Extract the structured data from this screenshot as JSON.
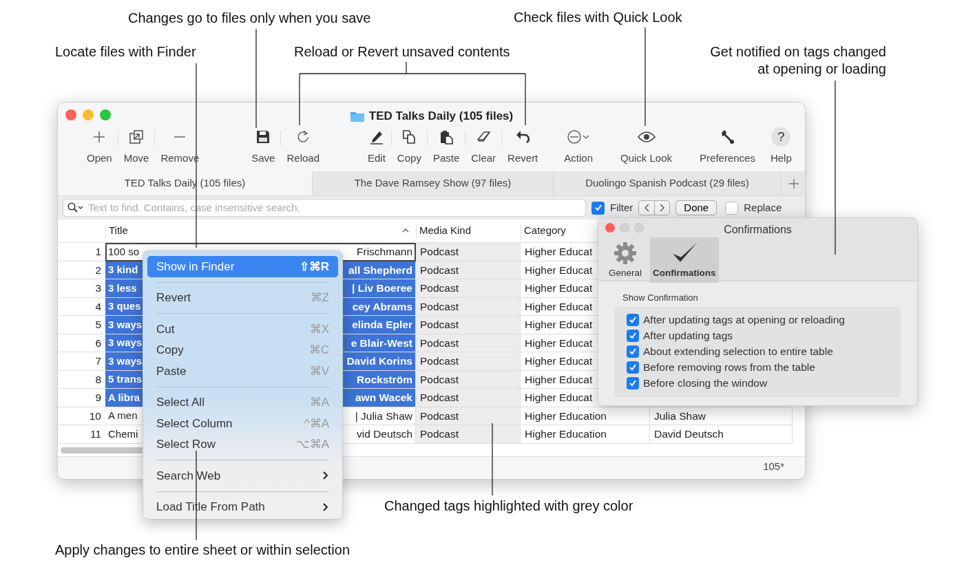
{
  "callouts": [
    {
      "text": "Changes go to files only when you save"
    },
    {
      "text": "Locate files with Finder"
    },
    {
      "text": "Reload or Revert unsaved contents"
    },
    {
      "text": "Check files with Quick Look"
    },
    {
      "text": "Get notified on tags changed\nat opening or loading"
    },
    {
      "text": "Changed tags highlighted with grey color"
    },
    {
      "text": "Apply changes to entire sheet or within selection"
    }
  ],
  "window": {
    "title": "TED Talks Daily (105 files)",
    "toolbar": {
      "groups": [
        {
          "items": [
            {
              "label": "Open",
              "kind": "plus"
            },
            {
              "label": "Move",
              "kind": "move"
            },
            {
              "label": "Remove",
              "kind": "minus"
            }
          ]
        },
        {
          "items": [
            {
              "label": "Save",
              "kind": "save"
            },
            {
              "label": "Reload",
              "kind": "reload"
            }
          ]
        },
        {
          "items": [
            {
              "label": "Edit",
              "kind": "pencil"
            },
            {
              "label": "Copy",
              "kind": "copy"
            },
            {
              "label": "Paste",
              "kind": "paste"
            },
            {
              "label": "Clear",
              "kind": "eraser"
            },
            {
              "label": "Revert",
              "kind": "undo"
            }
          ]
        },
        {
          "items": [
            {
              "label": "Action",
              "kind": "action"
            }
          ]
        },
        {
          "items": [
            {
              "label": "Quick Look",
              "kind": "eye"
            }
          ]
        },
        {
          "items": [
            {
              "label": "Preferences",
              "kind": "wrench"
            }
          ]
        },
        {
          "items": [
            {
              "label": "Help",
              "kind": "help",
              "glyph": "?"
            }
          ]
        }
      ]
    },
    "tabs": [
      {
        "label": "TED Talks Daily (105 files)",
        "selected": true
      },
      {
        "label": "The Dave Ramsey Show (97 files)",
        "selected": false
      },
      {
        "label": "Duolingo Spanish Podcast (29 files)",
        "selected": false
      }
    ],
    "search": {
      "placeholder": "Text to find. Contains, case insensitive search.",
      "filter": {
        "label": "Filter",
        "checked": true
      },
      "done": "Done",
      "replace": {
        "label": "Replace",
        "checked": false
      }
    },
    "table": {
      "columns": [
        "Title",
        "Media Kind",
        "Category"
      ],
      "rows": [
        {
          "number": "1",
          "title_start": "100 so",
          "title_end": "Frischmann",
          "media_kind": "Podcast",
          "category": "Higher Educat",
          "selected": false,
          "focused": true,
          "changed": true
        },
        {
          "number": "2",
          "title_start": "3 kind",
          "title_end": "all Shepherd",
          "media_kind": "Podcast",
          "category": "Higher Educat",
          "selected": true,
          "focused": false,
          "changed": true
        },
        {
          "number": "3",
          "title_start": "3 less",
          "title_end": "| Liv Boeree",
          "media_kind": "Podcast",
          "category": "Higher Educat",
          "selected": true,
          "focused": false,
          "changed": true
        },
        {
          "number": "4",
          "title_start": "3 ques",
          "title_end": "cey Abrams",
          "media_kind": "Podcast",
          "category": "Higher Educat",
          "selected": true,
          "focused": false,
          "changed": true
        },
        {
          "number": "5",
          "title_start": "3 ways",
          "title_end": "elinda Epler",
          "media_kind": "Podcast",
          "category": "Higher Educat",
          "selected": true,
          "focused": false,
          "changed": true
        },
        {
          "number": "6",
          "title_start": "3 ways",
          "title_end": "e Blair-West",
          "media_kind": "Podcast",
          "category": "Higher Educat",
          "selected": true,
          "focused": false,
          "changed": true
        },
        {
          "number": "7",
          "title_start": "3 ways",
          "title_end": "David Korins",
          "media_kind": "Podcast",
          "category": "Higher Educat",
          "selected": true,
          "focused": false,
          "changed": true
        },
        {
          "number": "8",
          "title_start": "5 trans",
          "title_end": "Rockström",
          "media_kind": "Podcast",
          "category": "Higher Educat",
          "selected": true,
          "focused": false,
          "changed": true
        },
        {
          "number": "9",
          "title_start": "A libra",
          "title_end": "awn Wacek",
          "media_kind": "Podcast",
          "category": "Higher Educat",
          "selected": true,
          "focused": false,
          "changed": true
        },
        {
          "number": "10",
          "title_start": "A men",
          "title_end": "| Julia Shaw",
          "media_kind": "Podcast",
          "category": "Higher Education",
          "column_4": "Julia Shaw",
          "selected": false,
          "focused": false,
          "changed": true
        },
        {
          "number": "11",
          "title_start": "Chemi",
          "title_end": "vid Deutsch",
          "media_kind": "Podcast",
          "category": "Higher Education",
          "column_4": "David Deutsch",
          "selected": false,
          "focused": false,
          "changed": true
        }
      ]
    },
    "status": "105*"
  },
  "context_menu": [
    {
      "kind": "item",
      "label": "Show in Finder",
      "shortcut": "⇧⌘R",
      "selected": true
    },
    {
      "kind": "separator"
    },
    {
      "kind": "item",
      "label": "Revert",
      "shortcut": "⌘Z",
      "selected": false
    },
    {
      "kind": "separator"
    },
    {
      "kind": "item",
      "label": "Cut",
      "shortcut": "⌘X",
      "selected": false
    },
    {
      "kind": "item",
      "label": "Copy",
      "shortcut": "⌘C",
      "selected": false
    },
    {
      "kind": "item",
      "label": "Paste",
      "shortcut": "⌘V",
      "selected": false
    },
    {
      "kind": "separator"
    },
    {
      "kind": "item",
      "label": "Select All",
      "shortcut": "⌘A",
      "selected": false
    },
    {
      "kind": "item",
      "label": "Select Column",
      "shortcut": "^⌘A",
      "selected": false
    },
    {
      "kind": "item",
      "label": "Select Row",
      "shortcut": "⌥⌘A",
      "selected": false
    },
    {
      "kind": "separator"
    },
    {
      "kind": "submenu",
      "label": "Search Web",
      "selected": false
    },
    {
      "kind": "separator"
    },
    {
      "kind": "submenu",
      "label": "Load Title From Path",
      "selected": false
    }
  ],
  "dialog": {
    "title": "Confirmations",
    "tabs": [
      {
        "label": "General",
        "kind": "gear",
        "selected": false
      },
      {
        "label": "Confirmations",
        "kind": "check",
        "selected": true
      }
    ],
    "group_label": "Show Confirmation",
    "options": [
      {
        "label": "After updating tags at opening or reloading",
        "checked": true
      },
      {
        "label": "After updating tags",
        "checked": true
      },
      {
        "label": "About extending selection to entire table",
        "checked": true
      },
      {
        "label": "Before removing rows from the table",
        "checked": true
      },
      {
        "label": "Before closing the window",
        "checked": true
      }
    ]
  }
}
